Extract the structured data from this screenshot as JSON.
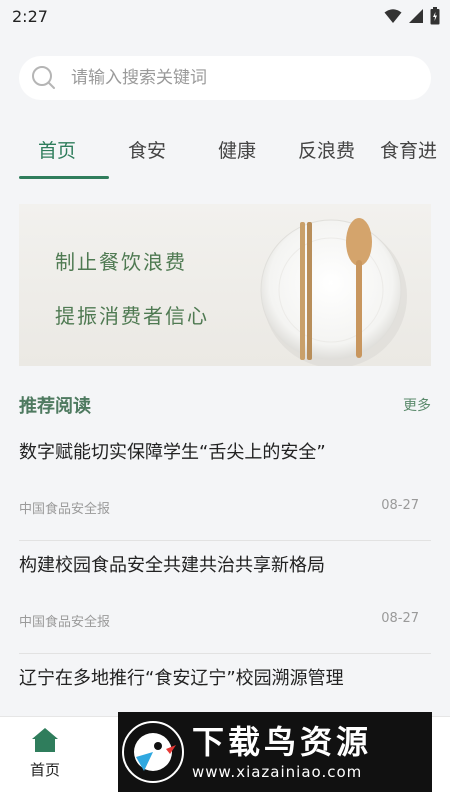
{
  "status_bar": {
    "time": "2:27"
  },
  "search": {
    "placeholder": "请输入搜索关键词"
  },
  "tabs": [
    {
      "label": "首页"
    },
    {
      "label": "食安"
    },
    {
      "label": "健康"
    },
    {
      "label": "反浪费"
    },
    {
      "label": "食育进"
    }
  ],
  "banner": {
    "line1": "制止餐饮浪费",
    "line2": "提振消费者信心"
  },
  "recommended": {
    "title": "推荐阅读",
    "more_label": "更多",
    "articles": [
      {
        "title": "数字赋能切实保障学生“舌尖上的安全”",
        "source": "中国食品安全报",
        "date": "08-27"
      },
      {
        "title": "构建校园食品安全共建共治共享新格局",
        "source": "中国食品安全报",
        "date": "08-27"
      },
      {
        "title": "辽宁在多地推行“食安辽宁”校园溯源管理"
      }
    ]
  },
  "bottom_nav": {
    "home_label": "首页"
  },
  "watermark": {
    "brand": "下载鸟资源",
    "url": "www.xiazainiao.com"
  },
  "colors": {
    "accent": "#2f7d5c",
    "banner_text": "#4f7a52",
    "background": "#f4f5f7"
  }
}
